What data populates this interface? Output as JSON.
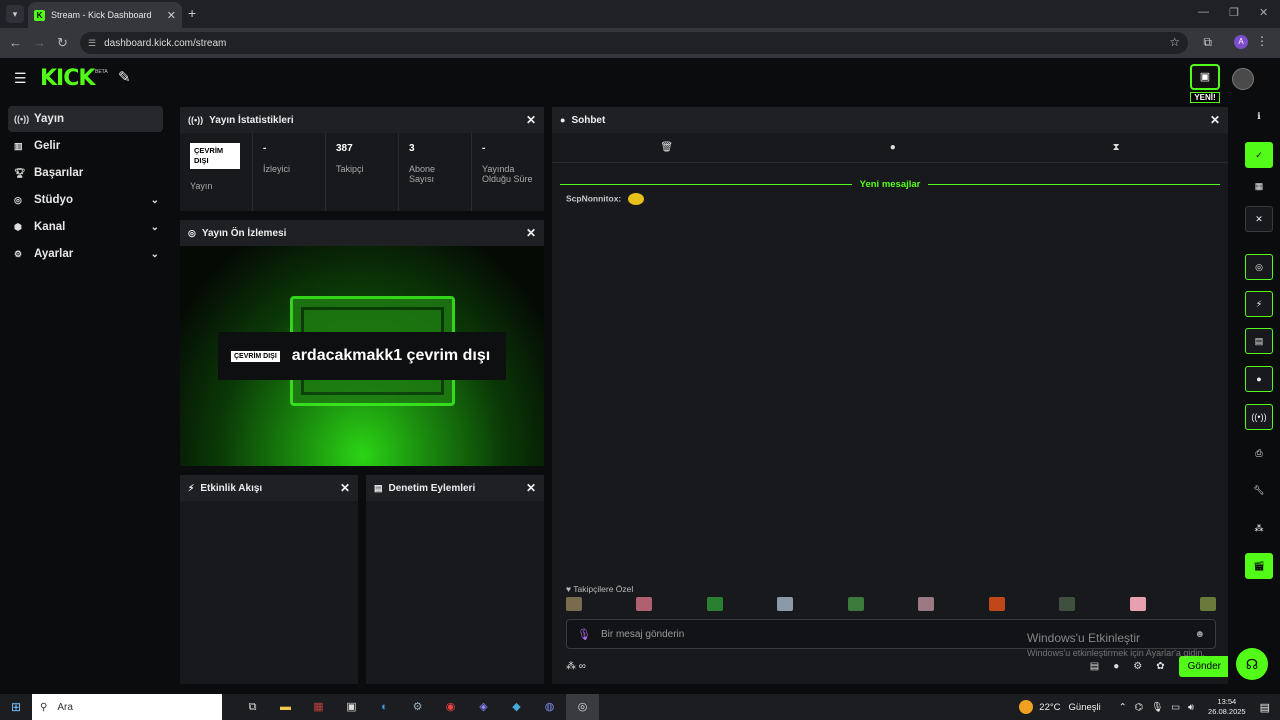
{
  "browser": {
    "tab_title": "Stream - Kick Dashboard",
    "tab_favicon": "K",
    "url": "dashboard.kick.com/stream",
    "profile_initial": "A"
  },
  "header": {
    "logo": "KICK",
    "beta": "BETA",
    "new_badge": "YENİ!"
  },
  "sidebar": {
    "items": [
      {
        "label": "Yayın",
        "icon": "broadcast-icon"
      },
      {
        "label": "Gelir",
        "icon": "revenue-icon"
      },
      {
        "label": "Başarılar",
        "icon": "trophy-icon"
      },
      {
        "label": "Stüdyo",
        "icon": "studio-icon"
      },
      {
        "label": "Kanal",
        "icon": "channel-icon"
      },
      {
        "label": "Ayarlar",
        "icon": "gear-icon"
      }
    ]
  },
  "stats": {
    "title": "Yayın İstatistikleri",
    "status_badge": "ÇEVRİM DIŞI",
    "status_label": "Yayın",
    "cells": [
      {
        "value": "-",
        "label": "İzleyici"
      },
      {
        "value": "387",
        "label": "Takipçi"
      },
      {
        "value": "3",
        "label": "Abone Sayısı"
      },
      {
        "value": "-",
        "label": "Yayında Olduğu Süre"
      }
    ]
  },
  "preview": {
    "title": "Yayın Ön İzlemesi",
    "badge": "ÇEVRİM DIŞI",
    "channel_text": "ardacakmakk1 çevrim dışı"
  },
  "activity": {
    "title": "Etkinlik Akışı"
  },
  "moderation": {
    "title": "Denetim Eylemleri"
  },
  "chat": {
    "title": "Sohbet",
    "new_messages": "Yeni mesajlar",
    "message_user": "ScpNonnitox:",
    "followers_only": "Takipçilere Özel",
    "input_placeholder": "Bir mesaj gönderin",
    "send_label": "Gönder",
    "emote_colors": [
      "#7a6a50",
      "#b06070",
      "#2a8030",
      "#8a9aa8",
      "#3c7a3c",
      "#9a7a80",
      "#c04818",
      "#405040",
      "#e8a0b0",
      "#6a7a3a"
    ]
  },
  "watermark": {
    "title": "Windows'u Etkinleştir",
    "sub": "Windows'u etkinleştirmek için Ayarlar'a gidin."
  },
  "taskbar": {
    "search_label": "Ara",
    "weather": "22°C",
    "weather_text": "Güneşli",
    "time": "13:54",
    "date": "26.08.2025"
  },
  "colors": {
    "accent": "#53fc18",
    "panel": "#18191c",
    "background": "#0b0c0e"
  }
}
